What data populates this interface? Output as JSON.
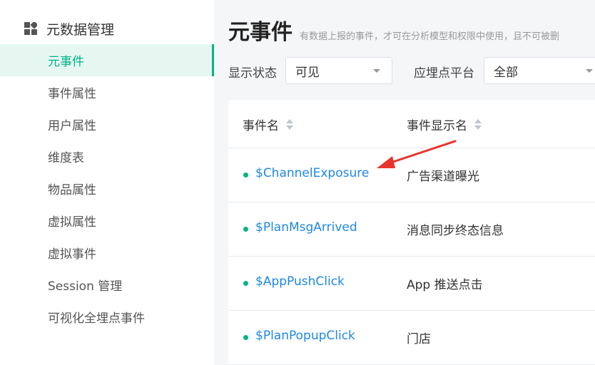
{
  "sidebar": {
    "header": "元数据管理",
    "items": [
      {
        "label": "元事件",
        "active": true
      },
      {
        "label": "事件属性",
        "active": false
      },
      {
        "label": "用户属性",
        "active": false
      },
      {
        "label": "维度表",
        "active": false
      },
      {
        "label": "物品属性",
        "active": false
      },
      {
        "label": "虚拟属性",
        "active": false
      },
      {
        "label": "虚拟事件",
        "active": false
      },
      {
        "label": "Session 管理",
        "active": false
      },
      {
        "label": "可视化全埋点事件",
        "active": false
      }
    ]
  },
  "main": {
    "title": "元事件",
    "description": "有数据上报的事件，才可在分析模型和权限中使用，且不可被删",
    "filters": {
      "status_label": "显示状态",
      "status_value": "可见",
      "platform_label": "应埋点平台",
      "platform_value": "全部"
    },
    "table": {
      "columns": [
        "事件名",
        "事件显示名"
      ],
      "rows": [
        {
          "name": "$ChannelExposure",
          "display": "广告渠道曝光"
        },
        {
          "name": "$PlanMsgArrived",
          "display": "消息同步终态信息"
        },
        {
          "name": "$AppPushClick",
          "display": "App 推送点击"
        },
        {
          "name": "$PlanPopupClick",
          "display": "门店"
        }
      ]
    }
  },
  "colors": {
    "accent": "#00b386",
    "link": "#1e88e5",
    "arrow": "#e8342a"
  },
  "icons": {
    "header": "grid-icon",
    "sort": "sort-icon",
    "dropdown": "caret-down-icon",
    "annotation": "red-arrow"
  }
}
